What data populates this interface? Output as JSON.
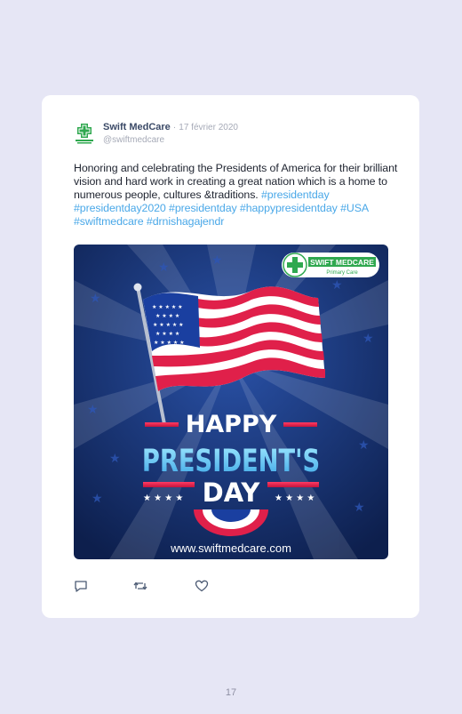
{
  "tweet": {
    "author_name": "Swift MedCare",
    "separator": "·",
    "date": "17 février 2020",
    "handle": "@swiftmedcare",
    "text": "Honoring and celebrating the Presidents of America for their brilliant vision and hard work in creating a great nation which is a home to numerous people, cultures &traditions.",
    "hashtags": "#presidentday #presidentday2020 #presidentday #happypresidentday #USA #swiftmedcare #drnishagajendr",
    "image": {
      "logo_title": "SWIFT MEDCARE",
      "logo_subtitle": "Primary Care",
      "headline_1": "HAPPY",
      "headline_2": "PRESIDENT'S",
      "headline_3": "DAY",
      "website": "www.swiftmedcare.com"
    },
    "actions": [
      "reply-icon",
      "retweet-icon",
      "heart-icon"
    ]
  },
  "page_number": "17",
  "colors": {
    "background": "#e6e6f5",
    "name": "#3b4a67",
    "hashtag": "#4aa8e8",
    "image_navy": "#13295e",
    "accent_red": "#e0204a",
    "brand_green": "#2fa84f"
  }
}
